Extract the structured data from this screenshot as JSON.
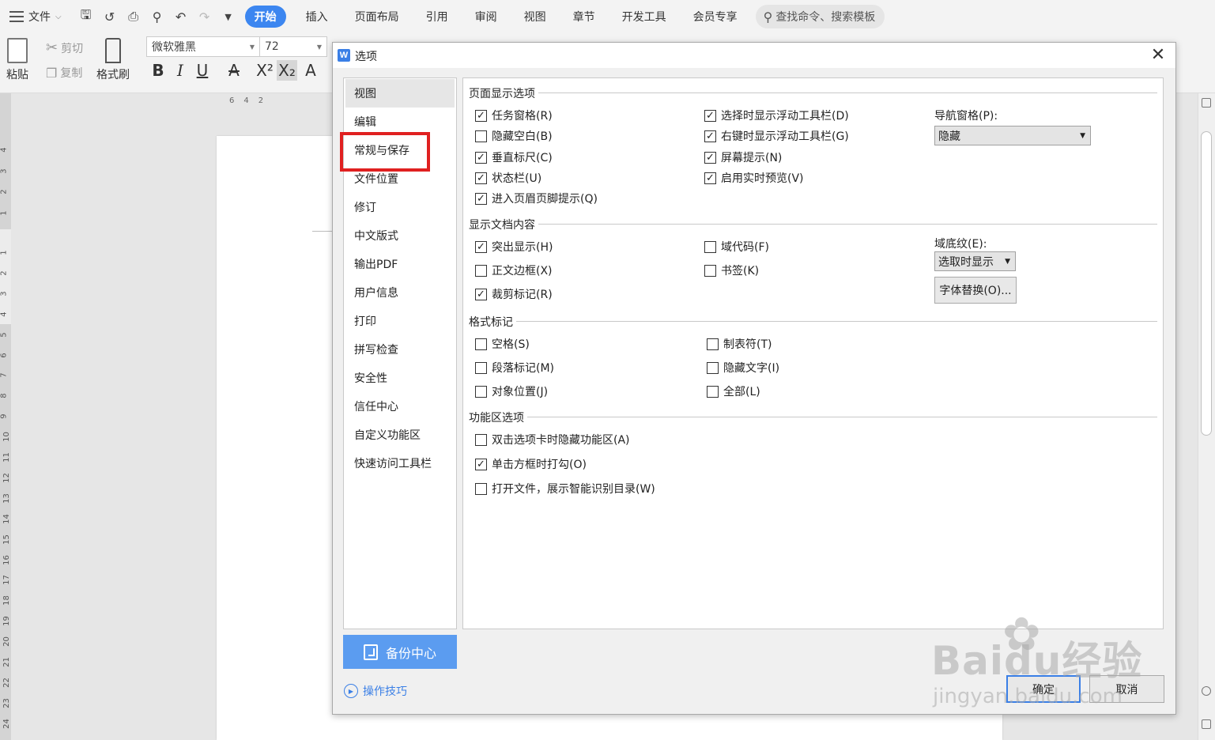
{
  "menubar": {
    "file_label": "文件",
    "tabs": [
      "开始",
      "插入",
      "页面布局",
      "引用",
      "审阅",
      "视图",
      "章节",
      "开发工具",
      "会员专享"
    ],
    "search_placeholder": "查找命令、搜索模板"
  },
  "ribbon": {
    "paste_label": "粘贴",
    "cut_label": "剪切",
    "copy_label": "复制",
    "format_painter_label": "格式刷",
    "font_name": "微软雅黑",
    "font_size": "72"
  },
  "ruler": {
    "h_ticks": [
      "6",
      "4",
      "2"
    ],
    "v_ticks": [
      "4",
      "3",
      "2",
      "1",
      "1",
      "2",
      "3",
      "4",
      "5",
      "6",
      "7",
      "8",
      "9",
      "10",
      "11",
      "12",
      "13",
      "14",
      "15",
      "16",
      "17",
      "18",
      "19",
      "20",
      "21",
      "22",
      "23",
      "24"
    ]
  },
  "dialog": {
    "title": "选项",
    "nav_items": [
      "视图",
      "编辑",
      "常规与保存",
      "文件位置",
      "修订",
      "中文版式",
      "输出PDF",
      "用户信息",
      "打印",
      "拼写检查",
      "安全性",
      "信任中心",
      "自定义功能区",
      "快速访问工具栏"
    ],
    "selected_nav": "视图",
    "highlighted_nav": "常规与保存",
    "backup_label": "备份中心",
    "tips_label": "操作技巧",
    "ok_label": "确定",
    "cancel_label": "取消",
    "sections": {
      "page_display": {
        "title": "页面显示选项",
        "col1": [
          {
            "label": "任务窗格(R)",
            "checked": true
          },
          {
            "label": "隐藏空白(B)",
            "checked": false
          },
          {
            "label": "垂直标尺(C)",
            "checked": true
          },
          {
            "label": "状态栏(U)",
            "checked": true
          },
          {
            "label": "进入页眉页脚提示(Q)",
            "checked": true
          }
        ],
        "col2": [
          {
            "label": "选择时显示浮动工具栏(D)",
            "checked": true
          },
          {
            "label": "右键时显示浮动工具栏(G)",
            "checked": true
          },
          {
            "label": "屏幕提示(N)",
            "checked": true
          },
          {
            "label": "启用实时预览(V)",
            "checked": true
          }
        ],
        "nav_pane_label": "导航窗格(P):",
        "nav_pane_value": "隐藏"
      },
      "doc_content": {
        "title": "显示文档内容",
        "col1": [
          {
            "label": "突出显示(H)",
            "checked": true
          },
          {
            "label": "正文边框(X)",
            "checked": false
          },
          {
            "label": "裁剪标记(R)",
            "checked": true
          }
        ],
        "col2": [
          {
            "label": "域代码(F)",
            "checked": false
          },
          {
            "label": "书签(K)",
            "checked": false
          }
        ],
        "field_shading_label": "域底纹(E):",
        "field_shading_value": "选取时显示",
        "font_sub_button": "字体替换(O)..."
      },
      "format_marks": {
        "title": "格式标记",
        "col1": [
          {
            "label": "空格(S)",
            "checked": false
          },
          {
            "label": "段落标记(M)",
            "checked": false
          },
          {
            "label": "对象位置(J)",
            "checked": false
          }
        ],
        "col2": [
          {
            "label": "制表符(T)",
            "checked": false
          },
          {
            "label": "隐藏文字(I)",
            "checked": false
          },
          {
            "label": "全部(L)",
            "checked": false
          }
        ]
      },
      "ribbon_options": {
        "title": "功能区选项",
        "items": [
          {
            "label": "双击选项卡时隐藏功能区(A)",
            "checked": false
          },
          {
            "label": "单击方框时打勾(O)",
            "checked": true
          },
          {
            "label": "打开文件，展示智能识别目录(W)",
            "checked": false
          }
        ]
      }
    }
  },
  "watermark": {
    "brand": "Baidu经验",
    "url": "jingyan.baidu.com"
  },
  "colors": {
    "accent": "#3c86f0",
    "highlight_red": "#e02020",
    "backup_button": "#5b9cf0"
  }
}
